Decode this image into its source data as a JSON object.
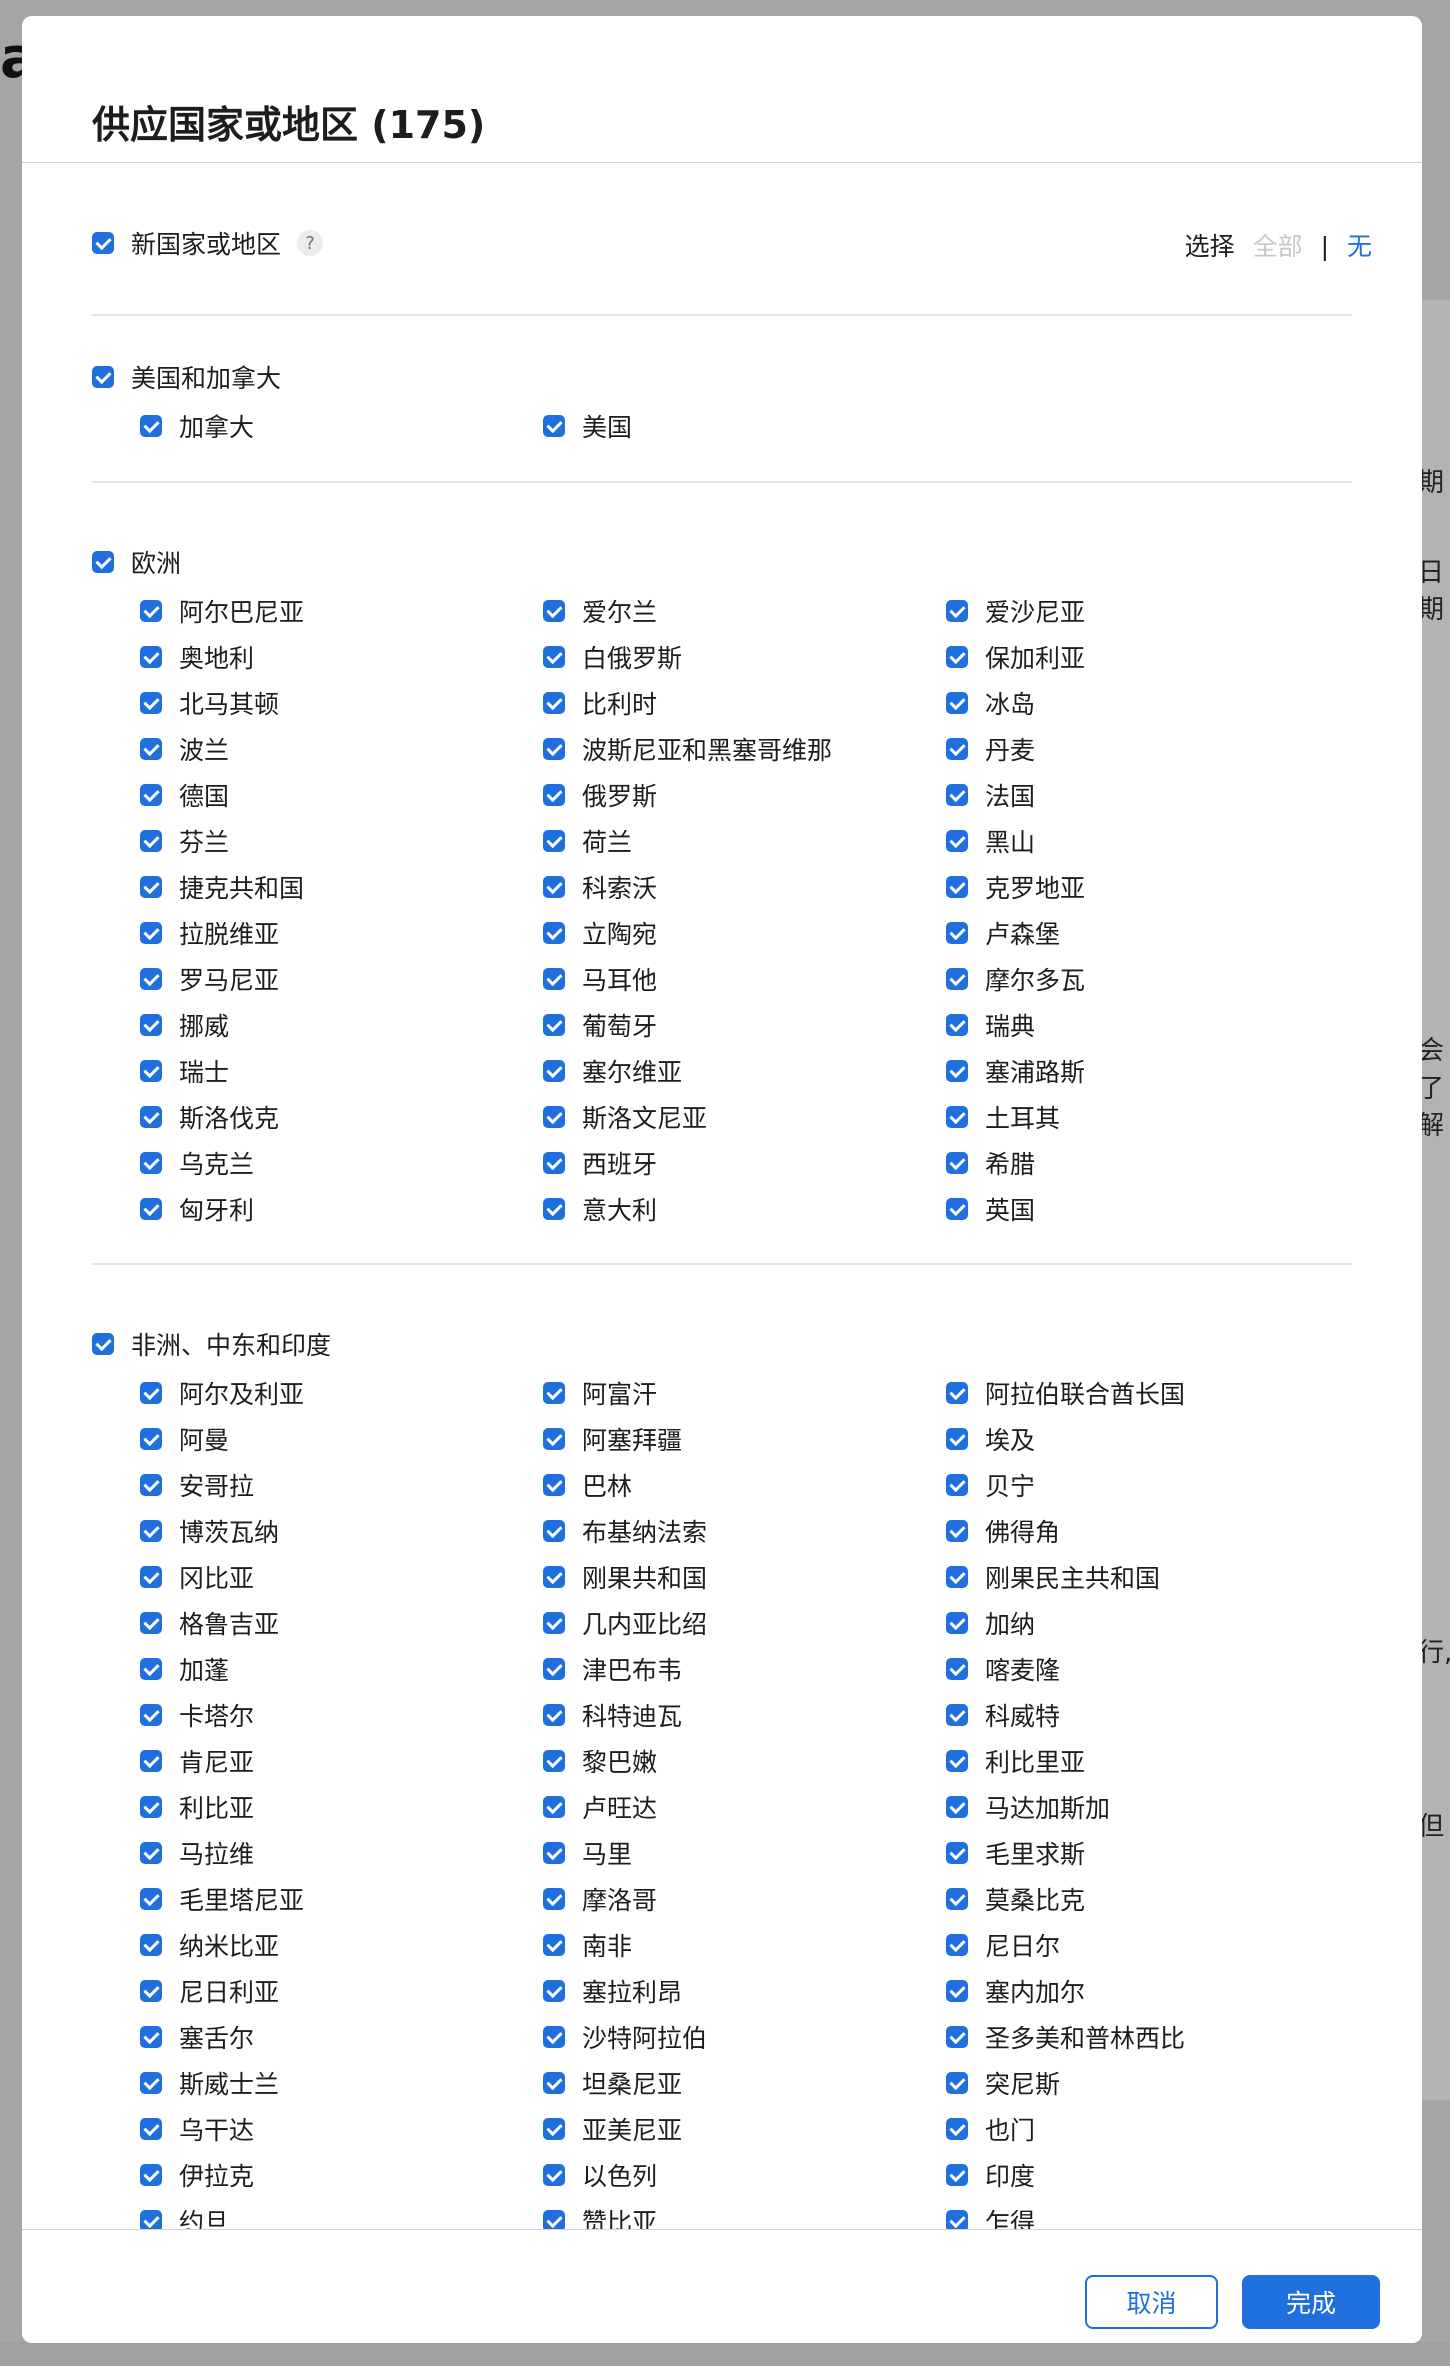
{
  "modal": {
    "title": "供应国家或地区 (175)",
    "new_regions": {
      "label": "新国家或地区",
      "help": "?"
    },
    "select": {
      "label": "选择",
      "all": "全部",
      "separator": "|",
      "none": "无"
    },
    "footer": {
      "cancel": "取消",
      "done": "完成"
    }
  },
  "colors": {
    "accent": "#1f6fde",
    "muted": "#c7c7cc",
    "divider": "#e3e3e6"
  },
  "regions": [
    {
      "name": "美国和加拿大",
      "items": [
        "加拿大",
        "美国"
      ]
    },
    {
      "name": "欧洲",
      "items": [
        "阿尔巴尼亚",
        "爱尔兰",
        "爱沙尼亚",
        "奥地利",
        "白俄罗斯",
        "保加利亚",
        "北马其顿",
        "比利时",
        "冰岛",
        "波兰",
        "波斯尼亚和黑塞哥维那",
        "丹麦",
        "德国",
        "俄罗斯",
        "法国",
        "芬兰",
        "荷兰",
        "黑山",
        "捷克共和国",
        "科索沃",
        "克罗地亚",
        "拉脱维亚",
        "立陶宛",
        "卢森堡",
        "罗马尼亚",
        "马耳他",
        "摩尔多瓦",
        "挪威",
        "葡萄牙",
        "瑞典",
        "瑞士",
        "塞尔维亚",
        "塞浦路斯",
        "斯洛伐克",
        "斯洛文尼亚",
        "土耳其",
        "乌克兰",
        "西班牙",
        "希腊",
        "匈牙利",
        "意大利",
        "英国"
      ]
    },
    {
      "name": "非洲、中东和印度",
      "items": [
        "阿尔及利亚",
        "阿富汗",
        "阿拉伯联合酋长国",
        "阿曼",
        "阿塞拜疆",
        "埃及",
        "安哥拉",
        "巴林",
        "贝宁",
        "博茨瓦纳",
        "布基纳法索",
        "佛得角",
        "冈比亚",
        "刚果共和国",
        "刚果民主共和国",
        "格鲁吉亚",
        "几内亚比绍",
        "加纳",
        "加蓬",
        "津巴布韦",
        "喀麦隆",
        "卡塔尔",
        "科特迪瓦",
        "科威特",
        "肯尼亚",
        "黎巴嫩",
        "利比里亚",
        "利比亚",
        "卢旺达",
        "马达加斯加",
        "马拉维",
        "马里",
        "毛里求斯",
        "毛里塔尼亚",
        "摩洛哥",
        "莫桑比克",
        "纳米比亚",
        "南非",
        "尼日尔",
        "尼日利亚",
        "塞拉利昂",
        "塞内加尔",
        "塞舌尔",
        "沙特阿拉伯",
        "圣多美和普林西比",
        "斯威士兰",
        "坦桑尼亚",
        "突尼斯",
        "乌干达",
        "亚美尼亚",
        "也门",
        "伊拉克",
        "以色列",
        "印度",
        "约旦",
        "赞比亚",
        "乍得"
      ]
    }
  ],
  "background": {
    "right_texts": [
      "期",
      "日期",
      "会",
      "了解",
      "行,",
      "但"
    ]
  }
}
